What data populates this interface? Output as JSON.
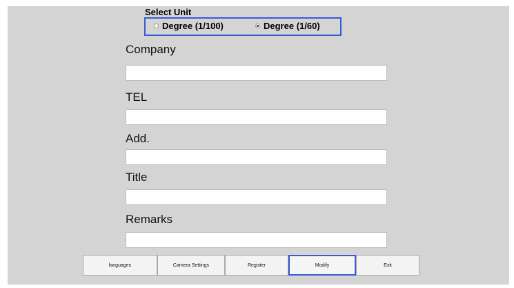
{
  "unit_select": {
    "title": "Select Unit",
    "options": [
      {
        "label": "Degree (1/100)",
        "checked": false
      },
      {
        "label": "Degree (1/60)",
        "checked": true
      }
    ]
  },
  "fields": {
    "company": {
      "label": "Company",
      "value": ""
    },
    "tel": {
      "label": "TEL",
      "value": ""
    },
    "address": {
      "label": "Add.",
      "value": ""
    },
    "title": {
      "label": "Title",
      "value": ""
    },
    "remarks": {
      "label": "Remarks",
      "value": ""
    }
  },
  "buttons": {
    "languages": "languages",
    "camera_settings": "Camera Settings",
    "register": "Register",
    "modify": "Modify",
    "exit": "Exit"
  },
  "colors": {
    "window_bg": "#d4d4d4",
    "accent_border": "#3a5bd0"
  }
}
